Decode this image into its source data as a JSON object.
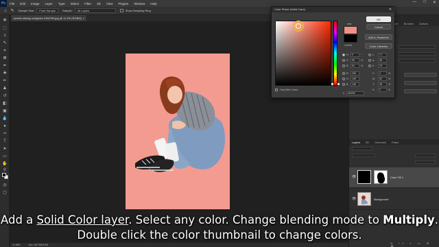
{
  "menubar": {
    "logo": "Ps",
    "items": [
      "File",
      "Edit",
      "Image",
      "Layer",
      "Type",
      "Select",
      "Filter",
      "3D",
      "View",
      "Plugins",
      "Window",
      "Help"
    ],
    "window_controls": [
      "—",
      "□",
      "✕"
    ]
  },
  "options_bar": {
    "sample_size_label": "Sample Size:",
    "sample_size_value": "Point Sample",
    "sample_label": "Sample:",
    "sample_value": "All Layers",
    "show_ring_label": "Show Sampling Ring"
  },
  "document": {
    "tab_title": "pexels-nikolay-seliginha-3166769.jpg @ 11.4% (RGB/8)",
    "close": "×",
    "zoom": "11.46%",
    "doc_info": "Doc: 68.7M/93.4M"
  },
  "color_picker": {
    "title": "Color Picker (Solid Color)",
    "close": "✕",
    "ok_label": "OK",
    "cancel_label": "Cancel",
    "add_swatches_label": "Add to Swatches",
    "libraries_label": "Color Libraries",
    "new_label": "new",
    "current_label": "current",
    "only_web_label": "Only Web Colors",
    "new_color": "#ef9284",
    "current_color": "#000000",
    "hsb": [
      {
        "label": "H:",
        "value": "9",
        "unit": "°"
      },
      {
        "label": "S:",
        "value": "39",
        "unit": "%"
      },
      {
        "label": "B:",
        "value": "94",
        "unit": "%"
      }
    ],
    "rgb": [
      {
        "label": "R:",
        "value": "239"
      },
      {
        "label": "G:",
        "value": "146"
      },
      {
        "label": "B:",
        "value": "146"
      }
    ],
    "lab": [
      {
        "label": "L:",
        "value": "71"
      },
      {
        "label": "a:",
        "value": "36"
      },
      {
        "label": "b:",
        "value": "19"
      }
    ],
    "cmyk": [
      {
        "label": "C:",
        "value": "2",
        "unit": "%"
      },
      {
        "label": "M:",
        "value": "52",
        "unit": "%"
      },
      {
        "label": "Y:",
        "value": "35",
        "unit": "%"
      },
      {
        "label": "K:",
        "value": "0",
        "unit": "%"
      }
    ],
    "hex_label": "#",
    "hex_value": "ef9292"
  },
  "right_panels": {
    "top_tabs": [
      "Learn",
      "Libraries",
      "Adjustments",
      "Properties",
      "Brushes",
      "Brush Settings",
      "Paragraph",
      "Brushes",
      "Actions"
    ],
    "layers_tabs": [
      "Layers",
      "3D",
      "Channels",
      "Paths"
    ],
    "layers": [
      {
        "name": "Color Fill 1"
      },
      {
        "name": "Background"
      }
    ]
  },
  "caption": {
    "line1_a": "Add a ",
    "line1_u": "Solid Color layer",
    "line1_b": ". Select any color. Change blending mode to ",
    "line1_bold": "Multiply",
    "line1_c": ".",
    "line2": "Double click the color thumbnail to change colors."
  }
}
